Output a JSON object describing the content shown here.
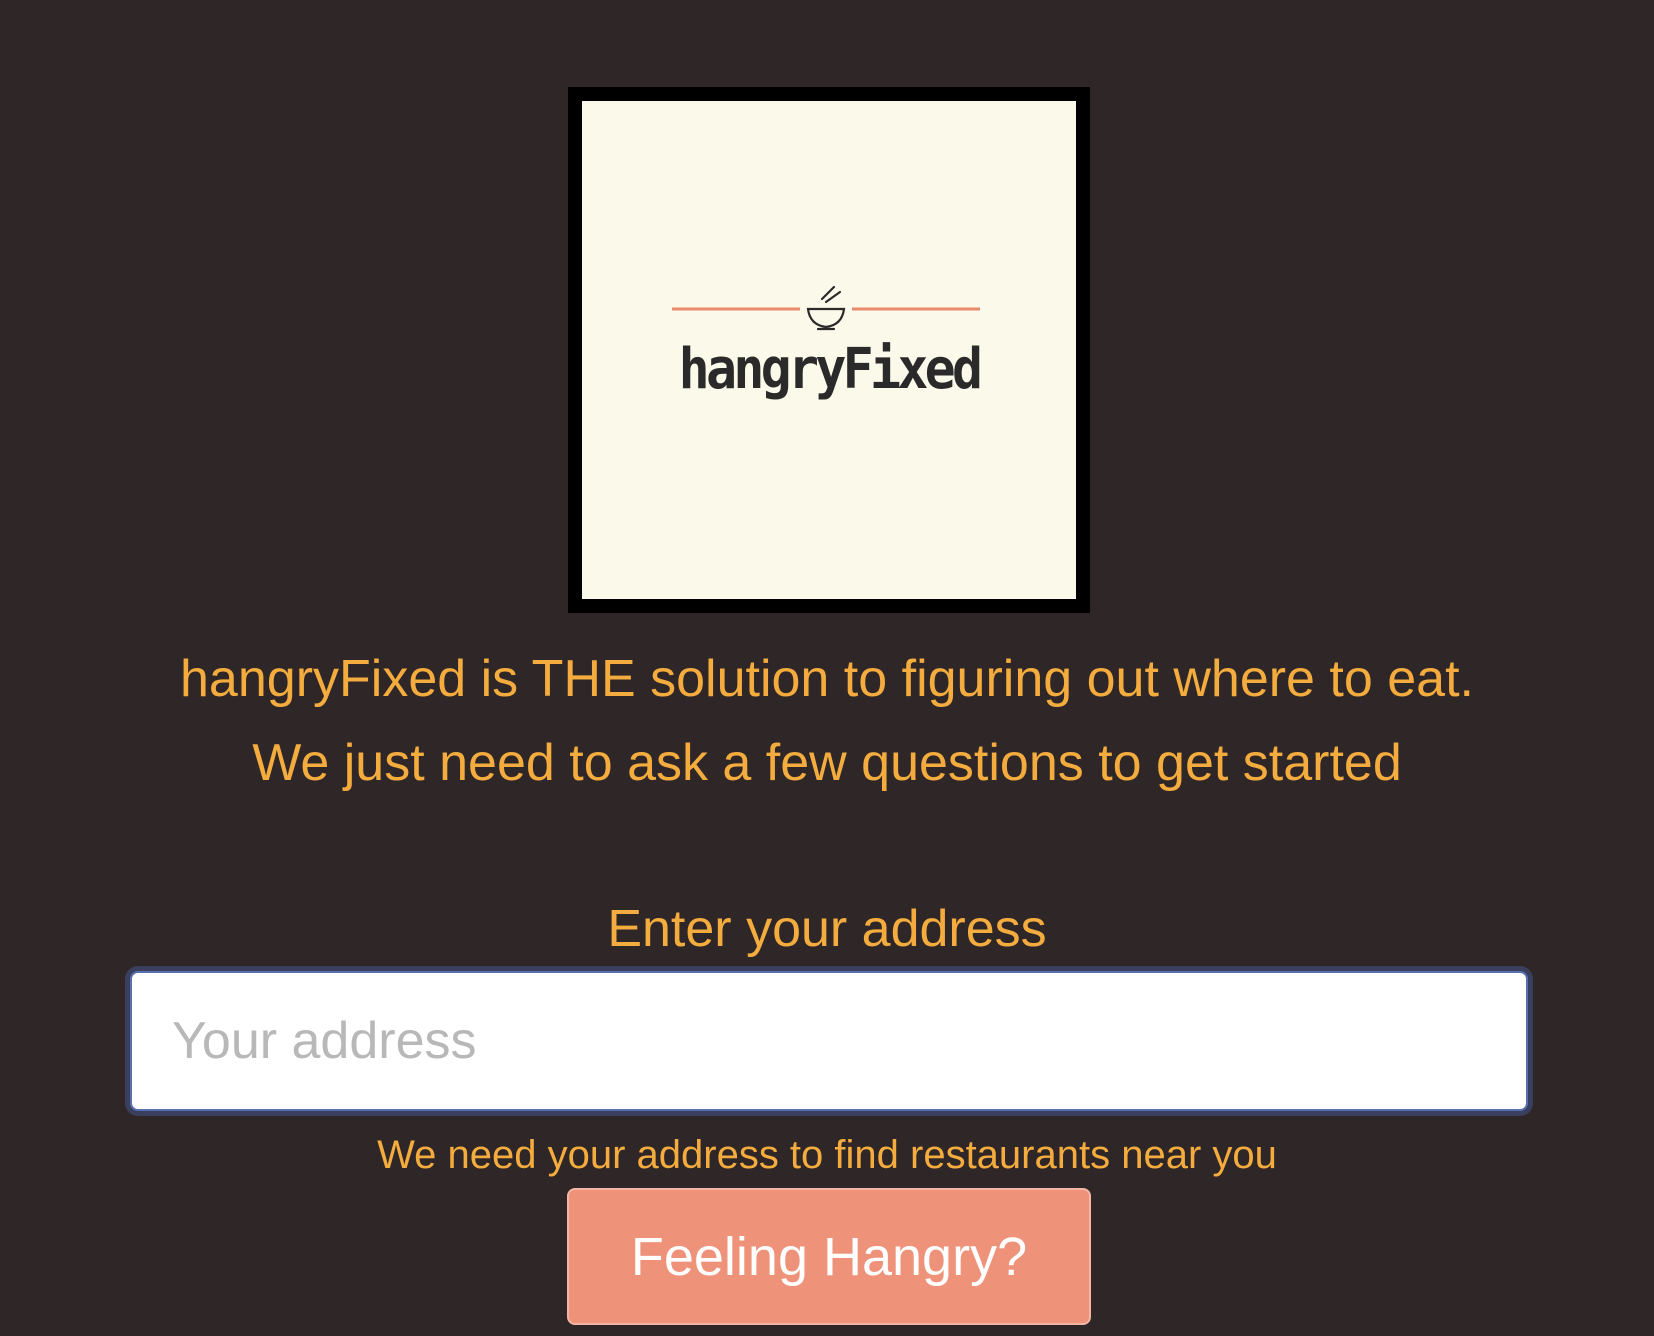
{
  "logo": {
    "wordmark": "hangryFixed",
    "icon": "bowl-chopsticks-icon",
    "colors": {
      "frame": "#000000",
      "background": "#fbf9e9",
      "rule": "#e88a6c",
      "text": "#2a2a2a"
    }
  },
  "intro": {
    "line1": "hangryFixed is THE solution to figuring out where to eat.",
    "line2": "We just need to ask a few questions to get started"
  },
  "address": {
    "label": "Enter your address",
    "value": "",
    "placeholder": "Your address",
    "help": "We need your address to find restaurants near you"
  },
  "submit": {
    "label": "Feeling Hangry?"
  },
  "theme": {
    "page_background": "#2f2627",
    "accent_text": "#f3ac3d",
    "button_background": "#ee927a",
    "input_focus_border": "#5a6fb0"
  }
}
